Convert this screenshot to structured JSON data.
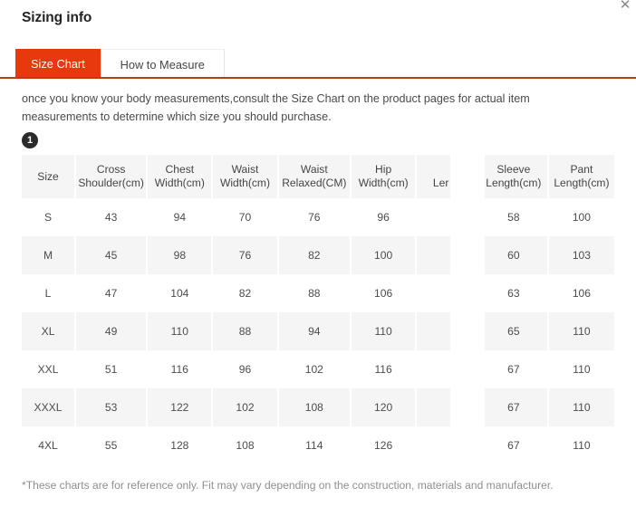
{
  "header": {
    "title": "Sizing info",
    "close_label": "✕"
  },
  "tabs": [
    {
      "label": "Size Chart",
      "active": true
    },
    {
      "label": "How to Measure",
      "active": false
    }
  ],
  "intro": {
    "text": "once you know your body measurements,consult the Size Chart on the product pages for actual item measurements to determine which size you should purchase.",
    "step_badge": "1"
  },
  "colors": {
    "accent": "#E8380D",
    "rule": "#B33F1A",
    "row_alt": "#f5f5f5",
    "badge": "#2b2b2b"
  },
  "chart_data": {
    "type": "table",
    "title": "Size Chart",
    "columns": [
      "Size",
      "Cross Shoulder(cm)",
      "Chest Width(cm)",
      "Waist Width(cm)",
      "Waist Relaxed(CM)",
      "Hip Width(cm)",
      "Ler          r )",
      "Sleeve Length(cm)",
      "Pant Length(cm)"
    ],
    "column_lines": [
      [
        "Size",
        ""
      ],
      [
        "Cross",
        "Shoulder(cm)"
      ],
      [
        "Chest",
        "Width(cm)"
      ],
      [
        "Waist",
        "Width(cm)"
      ],
      [
        "Waist",
        "Relaxed(CM)"
      ],
      [
        "Hip",
        "Width(cm)"
      ],
      [
        "",
        "Ler          r )"
      ],
      [
        "Sleeve",
        "Length(cm)"
      ],
      [
        "Pant",
        "Length(cm)"
      ]
    ],
    "rows": [
      {
        "cells": [
          "S",
          "43",
          "94",
          "70",
          "76",
          "96",
          "",
          "58",
          "100"
        ]
      },
      {
        "cells": [
          "M",
          "45",
          "98",
          "76",
          "82",
          "100",
          "",
          "60",
          "103"
        ]
      },
      {
        "cells": [
          "L",
          "47",
          "104",
          "82",
          "88",
          "106",
          "",
          "63",
          "106"
        ]
      },
      {
        "cells": [
          "XL",
          "49",
          "110",
          "88",
          "94",
          "110",
          "",
          "65",
          "110"
        ]
      },
      {
        "cells": [
          "XXL",
          "51",
          "116",
          "96",
          "102",
          "116",
          "",
          "67",
          "110"
        ]
      },
      {
        "cells": [
          "XXXL",
          "53",
          "122",
          "102",
          "108",
          "120",
          "",
          "67",
          "110"
        ]
      },
      {
        "cells": [
          "4XL",
          "55",
          "128",
          "108",
          "114",
          "126",
          "",
          "67",
          "110"
        ]
      }
    ]
  },
  "footnote": {
    "text": "*These charts are for reference only. Fit may vary depending on the construction, materials and manufacturer."
  }
}
